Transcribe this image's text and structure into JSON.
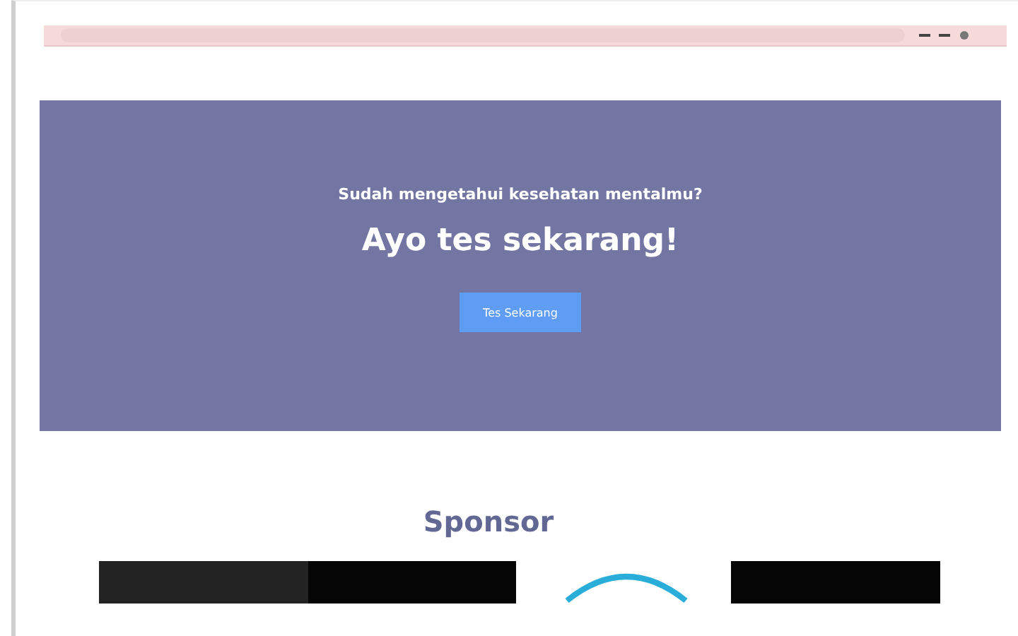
{
  "banner": {
    "question": "Sudah mengetahui kesehatan mentalmu?",
    "title": "Ayo tes sekarang!",
    "button": "Tes Sekarang"
  },
  "sponsor": {
    "heading": "Sponsor"
  }
}
